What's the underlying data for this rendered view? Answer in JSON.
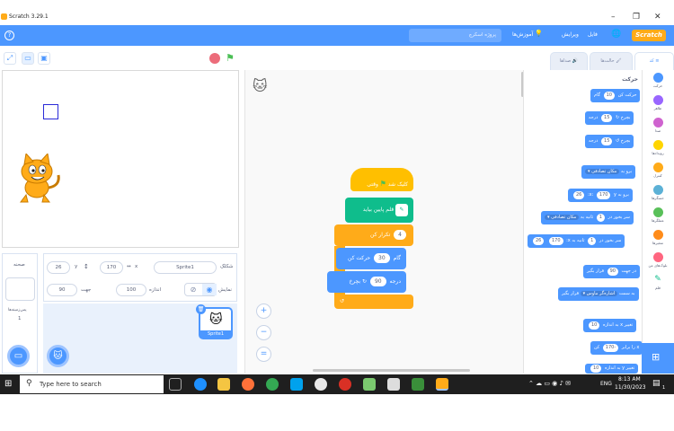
{
  "window": {
    "title": "Scratch 3.29.1",
    "minimize": "–",
    "maximize": "❐",
    "close": "✕"
  },
  "menubar": {
    "logo": "Scratch",
    "items": [
      "فایل",
      "ویرایش",
      "آموزش‌ها"
    ],
    "project_name": "پروژه اسکرچ",
    "globe": "🌐"
  },
  "stage_tools": {
    "small": "▭",
    "large": "▣",
    "full": "⤢"
  },
  "tabs": {
    "code": "کد",
    "costumes": "حالت‌ها",
    "sounds": "صداها"
  },
  "sprite_info": {
    "sprite_label": "شکلک",
    "sprite_name": "Sprite1",
    "x_label": "x",
    "x_value": "170",
    "y_label": "y",
    "y_value": "26",
    "show_label": "نمایش",
    "size_label": "اندازه",
    "size_value": "100",
    "direction_label": "جهت",
    "direction_value": "90"
  },
  "stage_panel": {
    "title": "صحنه",
    "backdrops_label": "پس‌زمینه‌ها",
    "backdrops_count": "1"
  },
  "sprites": [
    {
      "name": "Sprite1"
    }
  ],
  "script": {
    "when_flag": "وقتی",
    "when_flag_suffix": "کلیک شد",
    "pen_down": "قلم پایین بیاید",
    "repeat": "تکرار کن",
    "repeat_count": "4",
    "move": "حرکت کن",
    "move_steps": "30",
    "move_suffix": "گام",
    "turn": "بچرخ",
    "turn_degrees": "90",
    "turn_suffix": "درجه"
  },
  "palette": {
    "title": "حرکت",
    "blocks": [
      {
        "text": "حرکت کن",
        "value": "10",
        "suffix": "گام"
      },
      {
        "text": "بچرخ ↻",
        "value": "15",
        "suffix": "درجه"
      },
      {
        "text": "بچرخ ↺",
        "value": "15",
        "suffix": "درجه"
      },
      {
        "text": "برو به",
        "value": "مکان تصادفی ▾",
        "suffix": ""
      },
      {
        "text": "برو به x:",
        "value": "170",
        "suffix": "y:",
        "value2": "26"
      },
      {
        "text": "سر بخور در",
        "value": "1",
        "suffix": "ثانیه به",
        "value2": "مکان تصادفی ▾"
      },
      {
        "text": "سر بخور در",
        "value": "1",
        "suffix": "ثانیه به x:",
        "value2": "170",
        "value3": "26"
      },
      {
        "text": "در جهت",
        "value": "90",
        "suffix": "قرار بگیر"
      },
      {
        "text": "به سمت",
        "value": "اشاره‌گر ماوس ▾",
        "suffix": "قرار بگیر"
      },
      {
        "text": "تغییر x به اندازه",
        "value": "10",
        "suffix": ""
      },
      {
        "text": "x را برابر",
        "value": "-170",
        "suffix": "کن"
      },
      {
        "text": "تغییر y به اندازه",
        "value": "10",
        "suffix": ""
      }
    ]
  },
  "categories": [
    {
      "label": "حرکت",
      "color": "#4c97ff"
    },
    {
      "label": "ظاهر",
      "color": "#9966ff"
    },
    {
      "label": "صدا",
      "color": "#cf63cf"
    },
    {
      "label": "رویدادها",
      "color": "#ffd500"
    },
    {
      "label": "کنترل",
      "color": "#ffab19"
    },
    {
      "label": "حسگرها",
      "color": "#5cb1d6"
    },
    {
      "label": "عملگرها",
      "color": "#59c059"
    },
    {
      "label": "متغیرها",
      "color": "#ff8c1a"
    },
    {
      "label": "بلوک‌های من",
      "color": "#ff6680"
    },
    {
      "label": "قلم",
      "color": "#0fbd8c"
    }
  ],
  "zoom": {
    "in": "+",
    "out": "−",
    "reset": "="
  },
  "taskbar": {
    "search_placeholder": "Type here to search",
    "time": "8:13 AM",
    "date": "11/30/2023",
    "lang": "ENG",
    "notif_count": "1"
  }
}
